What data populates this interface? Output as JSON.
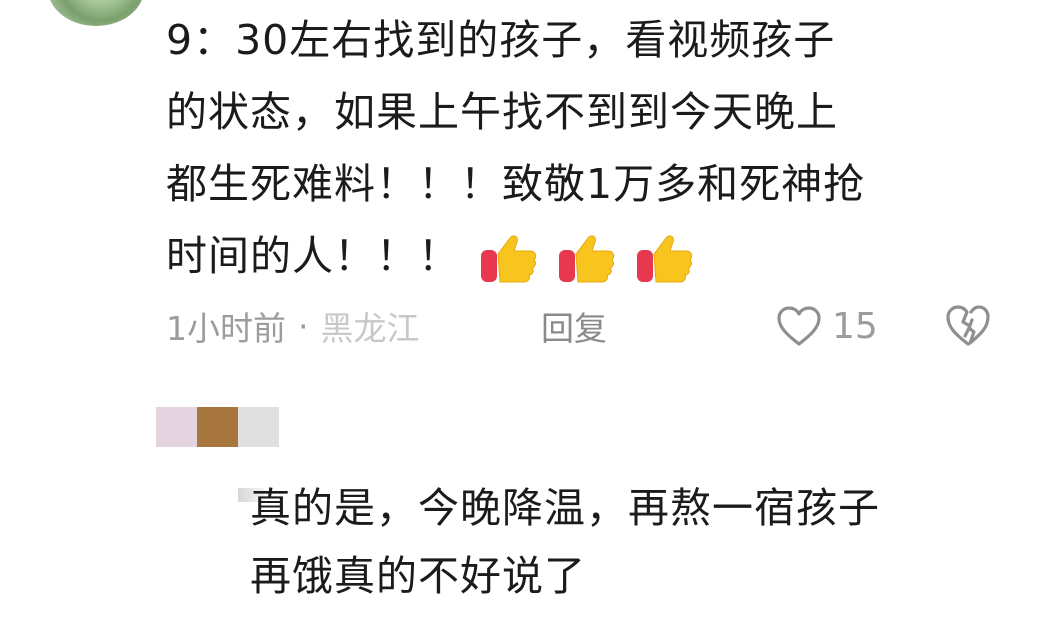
{
  "comment": {
    "lines": [
      "9：30左右找到的孩子，看视频孩子",
      "的状态，如果上午找不到到今天晚上",
      "都生死难料！！！致敬1万多和死神抢",
      "时间的人！！！"
    ],
    "emoji": [
      "thumbs-up-icon",
      "thumbs-up-icon",
      "thumbs-up-icon"
    ],
    "time": "1小时前",
    "separator": "·",
    "location": "黑龙江",
    "reply_label": "回复",
    "like_count": "15"
  },
  "reply": {
    "lines": [
      "真的是，今晚降温，再熬一宿孩子",
      "再饿真的不好说了"
    ]
  },
  "colors": {
    "text": "#1b1b1b",
    "meta": "#9c9c9c",
    "thumb_yellow": "#f7c51e",
    "thumb_red": "#e8384f",
    "censor": [
      "#e3d4df",
      "#a8763f",
      "#e0e0e0"
    ]
  }
}
